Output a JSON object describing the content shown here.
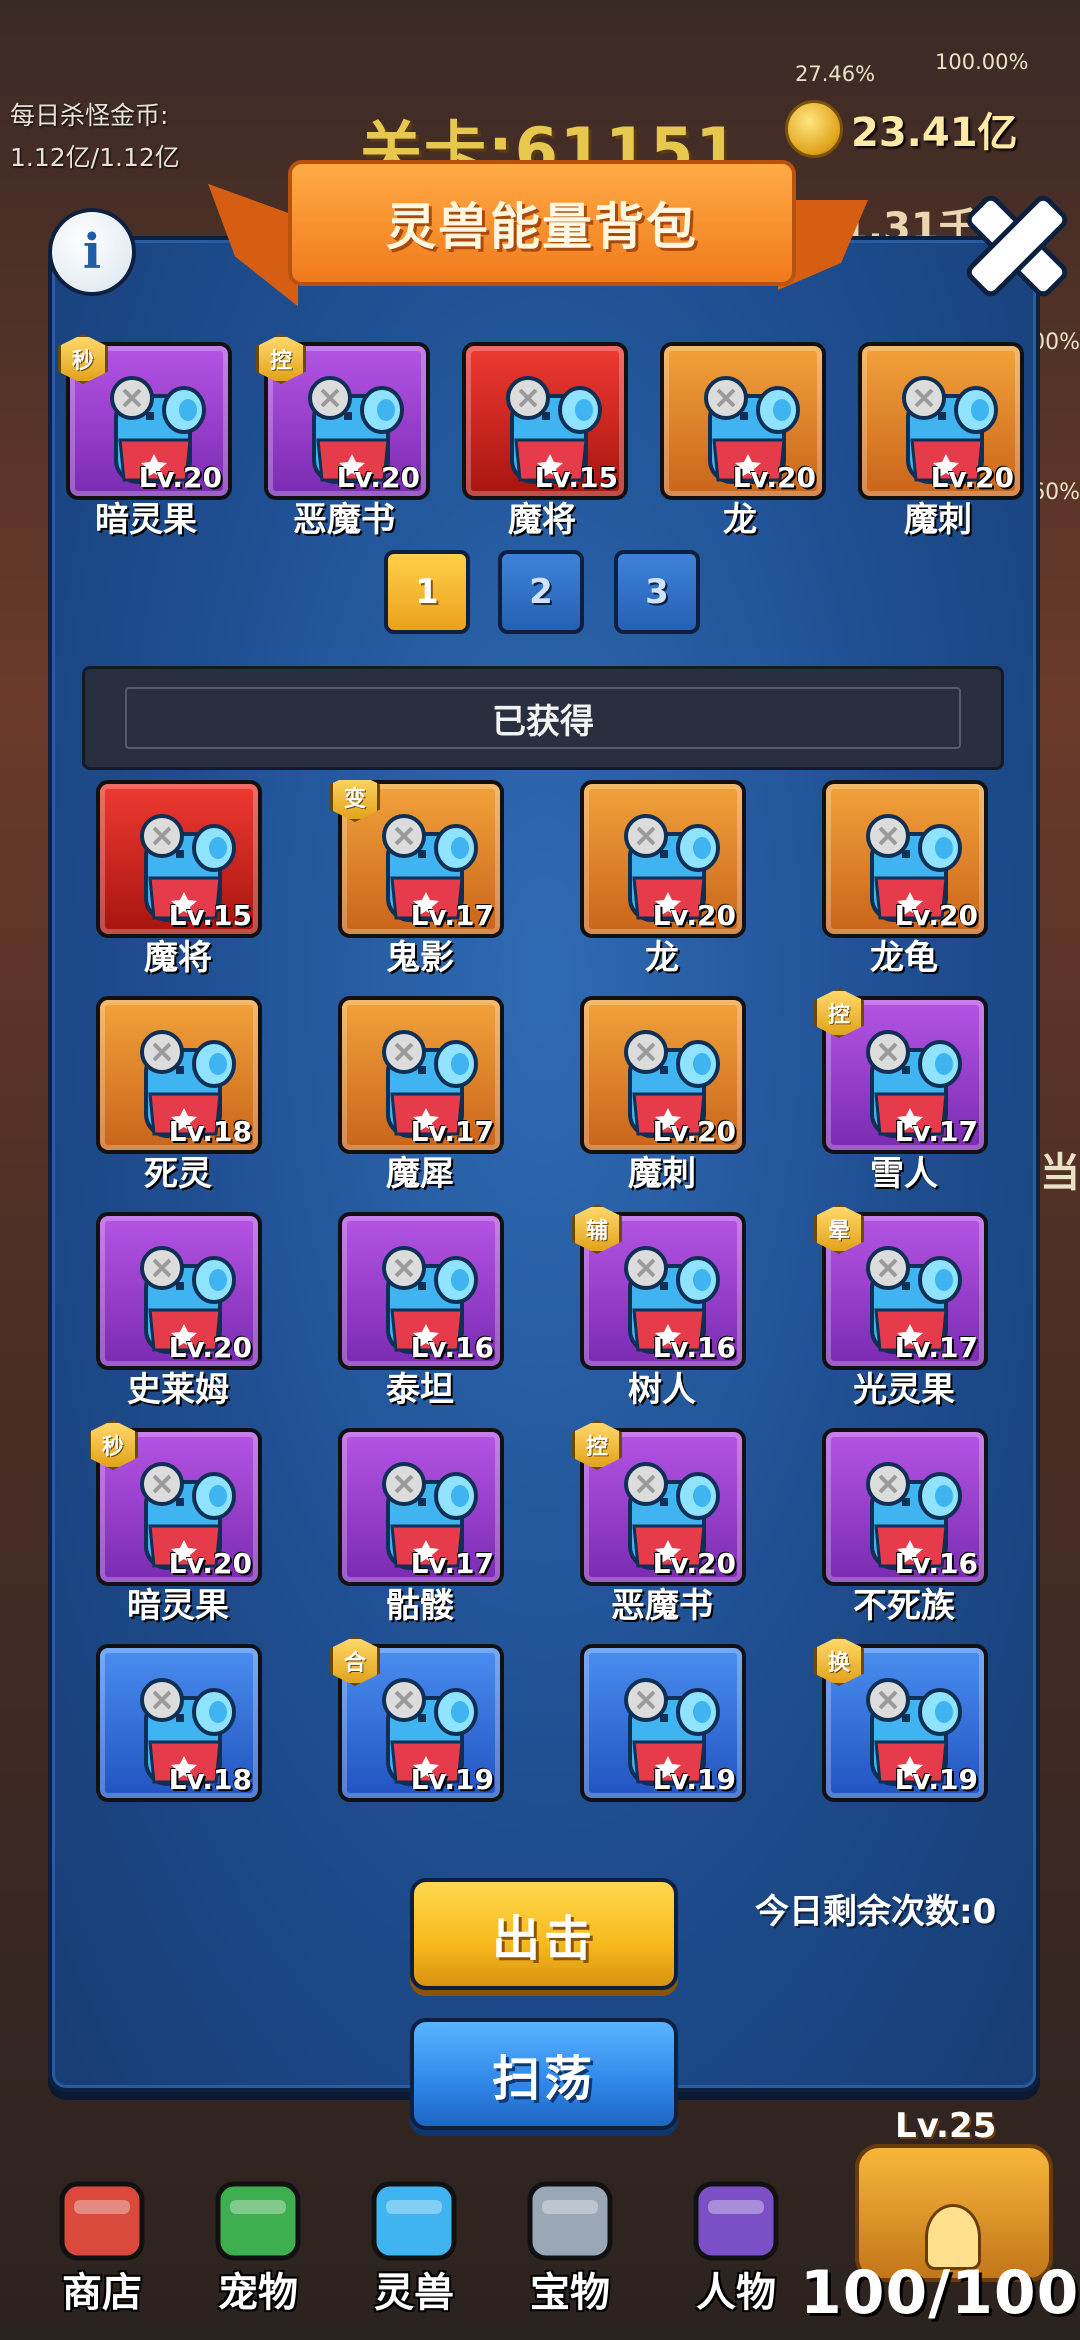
{
  "hud": {
    "daily_gold_label": "每日杀怪金币:",
    "daily_gold_value": "1.12亿/1.12亿",
    "level": "关卡:61151",
    "gold": "23.41亿",
    "sub_value": "1.31千",
    "pct_a": "27.46%",
    "pct_b": "100.00%",
    "side_a": "00%",
    "side_b": ".60%",
    "side_c": "当"
  },
  "panel": {
    "title": "灵兽能量背包",
    "info_glyph": "i",
    "obtained_label": "已获得",
    "remaining": "今日剩余次数:0",
    "attack_label": "出击",
    "sweep_label": "扫荡"
  },
  "equipped": [
    {
      "name": "暗灵果",
      "level": "Lv.20",
      "rarity": "purple",
      "badge": "秒"
    },
    {
      "name": "恶魔书",
      "level": "Lv.20",
      "rarity": "purple",
      "badge": "控"
    },
    {
      "name": "魔将",
      "level": "Lv.15",
      "rarity": "red",
      "badge": ""
    },
    {
      "name": "龙",
      "level": "Lv.20",
      "rarity": "orange",
      "badge": ""
    },
    {
      "name": "魔刺",
      "level": "Lv.20",
      "rarity": "orange",
      "badge": ""
    }
  ],
  "pages": [
    {
      "label": "1",
      "active": true
    },
    {
      "label": "2",
      "active": false
    },
    {
      "label": "3",
      "active": false
    }
  ],
  "obtained": [
    {
      "name": "魔将",
      "level": "Lv.15",
      "rarity": "red",
      "badge": ""
    },
    {
      "name": "鬼影",
      "level": "Lv.17",
      "rarity": "orange",
      "badge": "变"
    },
    {
      "name": "龙",
      "level": "Lv.20",
      "rarity": "orange",
      "badge": ""
    },
    {
      "name": "龙龟",
      "level": "Lv.20",
      "rarity": "orange",
      "badge": ""
    },
    {
      "name": "死灵",
      "level": "Lv.18",
      "rarity": "orange",
      "badge": ""
    },
    {
      "name": "魔犀",
      "level": "Lv.17",
      "rarity": "orange",
      "badge": ""
    },
    {
      "name": "魔刺",
      "level": "Lv.20",
      "rarity": "orange",
      "badge": ""
    },
    {
      "name": "雪人",
      "level": "Lv.17",
      "rarity": "purple",
      "badge": "控"
    },
    {
      "name": "史莱姆",
      "level": "Lv.20",
      "rarity": "purple",
      "badge": ""
    },
    {
      "name": "泰坦",
      "level": "Lv.16",
      "rarity": "purple",
      "badge": ""
    },
    {
      "name": "树人",
      "level": "Lv.16",
      "rarity": "purple",
      "badge": "辅"
    },
    {
      "name": "光灵果",
      "level": "Lv.17",
      "rarity": "purple",
      "badge": "晕"
    },
    {
      "name": "暗灵果",
      "level": "Lv.20",
      "rarity": "purple",
      "badge": "秒"
    },
    {
      "name": "骷髅",
      "level": "Lv.17",
      "rarity": "purple",
      "badge": ""
    },
    {
      "name": "恶魔书",
      "level": "Lv.20",
      "rarity": "purple",
      "badge": "控"
    },
    {
      "name": "不死族",
      "level": "Lv.16",
      "rarity": "purple",
      "badge": ""
    },
    {
      "name": "",
      "level": "Lv.18",
      "rarity": "blue",
      "badge": ""
    },
    {
      "name": "",
      "level": "Lv.19",
      "rarity": "blue",
      "badge": "合"
    },
    {
      "name": "",
      "level": "Lv.19",
      "rarity": "blue",
      "badge": ""
    },
    {
      "name": "",
      "level": "Lv.19",
      "rarity": "blue",
      "badge": "换"
    }
  ],
  "nav": [
    {
      "label": "商店",
      "icon": "shop-icon"
    },
    {
      "label": "宠物",
      "icon": "pet-icon"
    },
    {
      "label": "灵兽",
      "icon": "spirit-beast-icon"
    },
    {
      "label": "宝物",
      "icon": "treasure-swords-icon"
    },
    {
      "label": "人物",
      "icon": "character-book-icon"
    }
  ],
  "chest": {
    "level": "Lv.25",
    "counter": "100/100"
  }
}
